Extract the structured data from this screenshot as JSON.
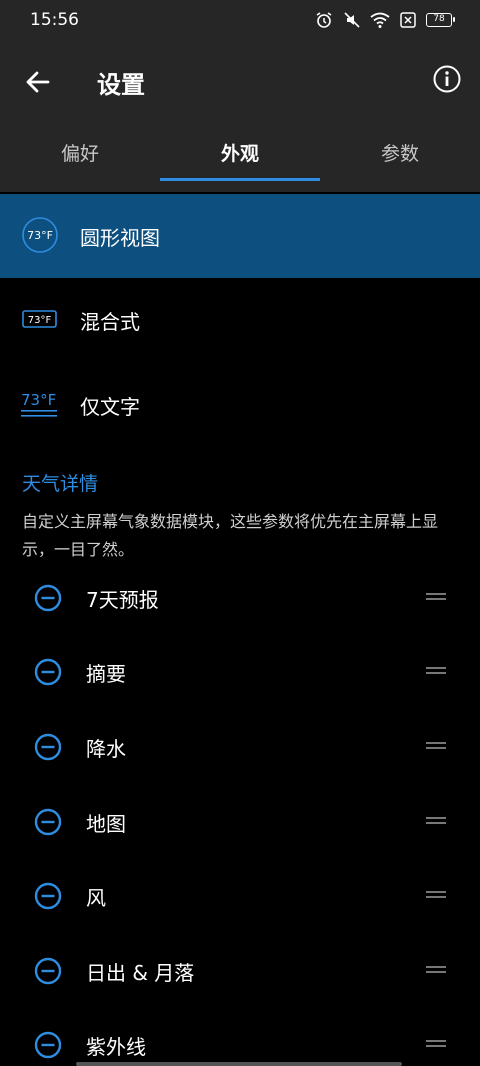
{
  "status": {
    "time": "15:56",
    "battery": "78"
  },
  "appbar": {
    "title": "设置"
  },
  "tabs": [
    {
      "label": "偏好",
      "active": false
    },
    {
      "label": "外观",
      "active": true
    },
    {
      "label": "参数",
      "active": false
    }
  ],
  "styles": [
    {
      "label": "圆形视图",
      "icon_text": "73°F",
      "selected": true
    },
    {
      "label": "混合式",
      "icon_text": "73°F",
      "selected": false
    },
    {
      "label": "仅文字",
      "icon_text": "73°F",
      "selected": false
    }
  ],
  "details": {
    "title": "天气详情",
    "description": "自定义主屏幕气象数据模块，这些参数将优先在主屏幕上显示，一目了然。",
    "items": [
      "7天预报",
      "摘要",
      "降水",
      "地图",
      "风",
      "日出 & 月落",
      "紫外线"
    ]
  },
  "colors": {
    "accent": "#2e8de0",
    "selected_bg": "#0d4f7e",
    "bar_bg": "#262626"
  }
}
